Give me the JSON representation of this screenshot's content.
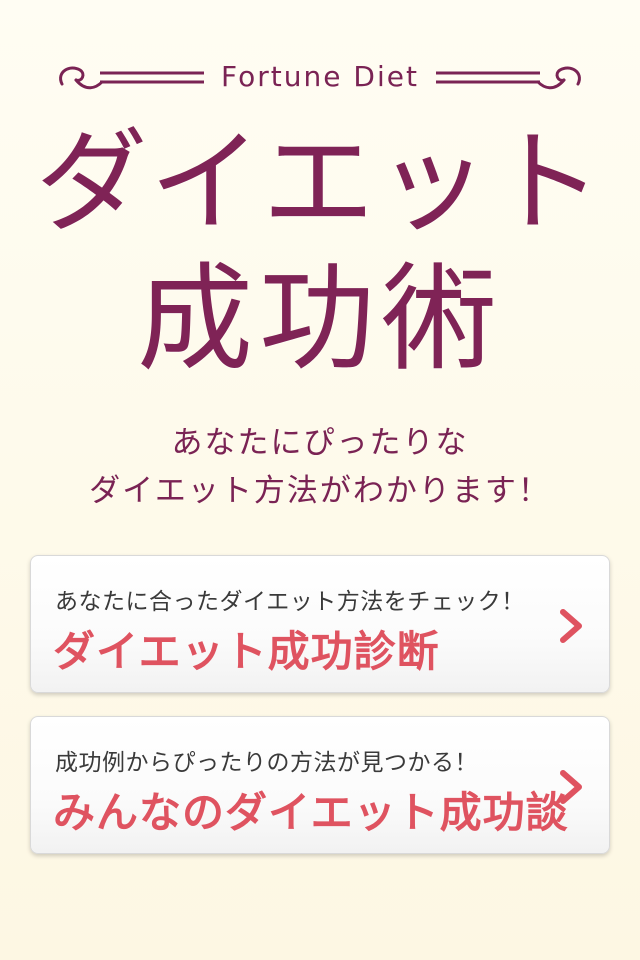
{
  "header": {
    "brand": "Fortune Diet",
    "title_line1": "ダイエット",
    "title_line2": "成功術"
  },
  "subtitle": {
    "line1": "あなたにぴったりな",
    "line2": "ダイエット方法がわかります！"
  },
  "cards": [
    {
      "label": "あなたに合ったダイエット方法をチェック！",
      "title": "ダイエット成功診断",
      "icon": "chevron-right-icon"
    },
    {
      "label": "成功例からぴったりの方法が見つかる！",
      "title": "みんなのダイエット成功談",
      "icon": "chevron-right-icon"
    }
  ],
  "colors": {
    "accent": "#7f2356",
    "card_title": "#df5360",
    "background": "#fffdf3"
  }
}
